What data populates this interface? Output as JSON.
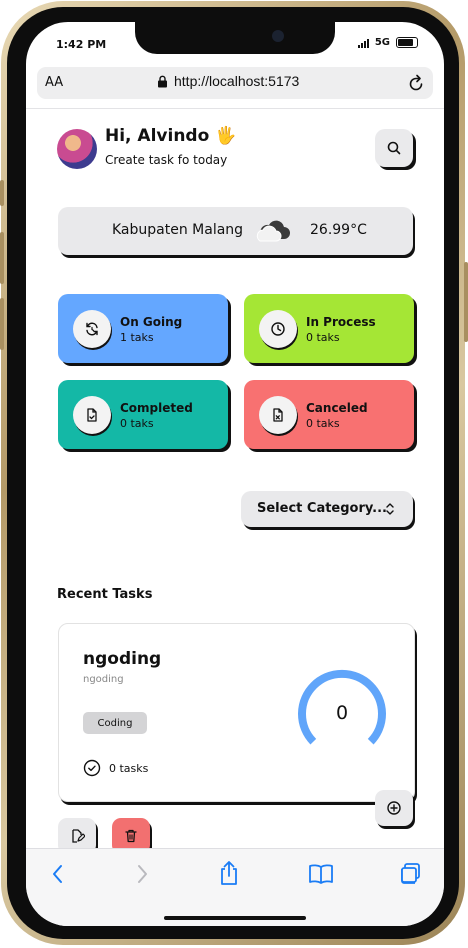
{
  "status": {
    "time": "1:42 PM",
    "network": "5G"
  },
  "browser": {
    "text_size_label": "AA",
    "url": "http://localhost:5173"
  },
  "header": {
    "greeting": "Hi, Alvindo 🖐",
    "subtitle": "Create task fo today"
  },
  "weather": {
    "location": "Kabupaten Malang",
    "temperature": "26.99°C",
    "icon": "cloud-icon"
  },
  "status_cards": [
    {
      "title": "On Going",
      "count": "1 taks",
      "color": "#64a7ff",
      "icon": "refresh-icon"
    },
    {
      "title": "In Process",
      "count": "0 taks",
      "color": "#a5e635",
      "icon": "clock-icon"
    },
    {
      "title": "Completed",
      "count": "0 taks",
      "color": "#14b8a6",
      "icon": "file-check-icon"
    },
    {
      "title": "Canceled",
      "count": "0 taks",
      "color": "#f87171",
      "icon": "file-x-icon"
    }
  ],
  "category_select": {
    "selected": "Select Category..."
  },
  "recent": {
    "heading": "Recent Tasks",
    "task": {
      "name": "ngoding",
      "description": "ngoding",
      "category": "Coding",
      "tasks_count": "0 tasks",
      "progress_value": "0",
      "ring_color": "#60a5fa"
    }
  },
  "colors": {
    "accent_blue": "#64a7ff",
    "danger": "#f27070",
    "ios_blue": "#1a7cf5"
  }
}
